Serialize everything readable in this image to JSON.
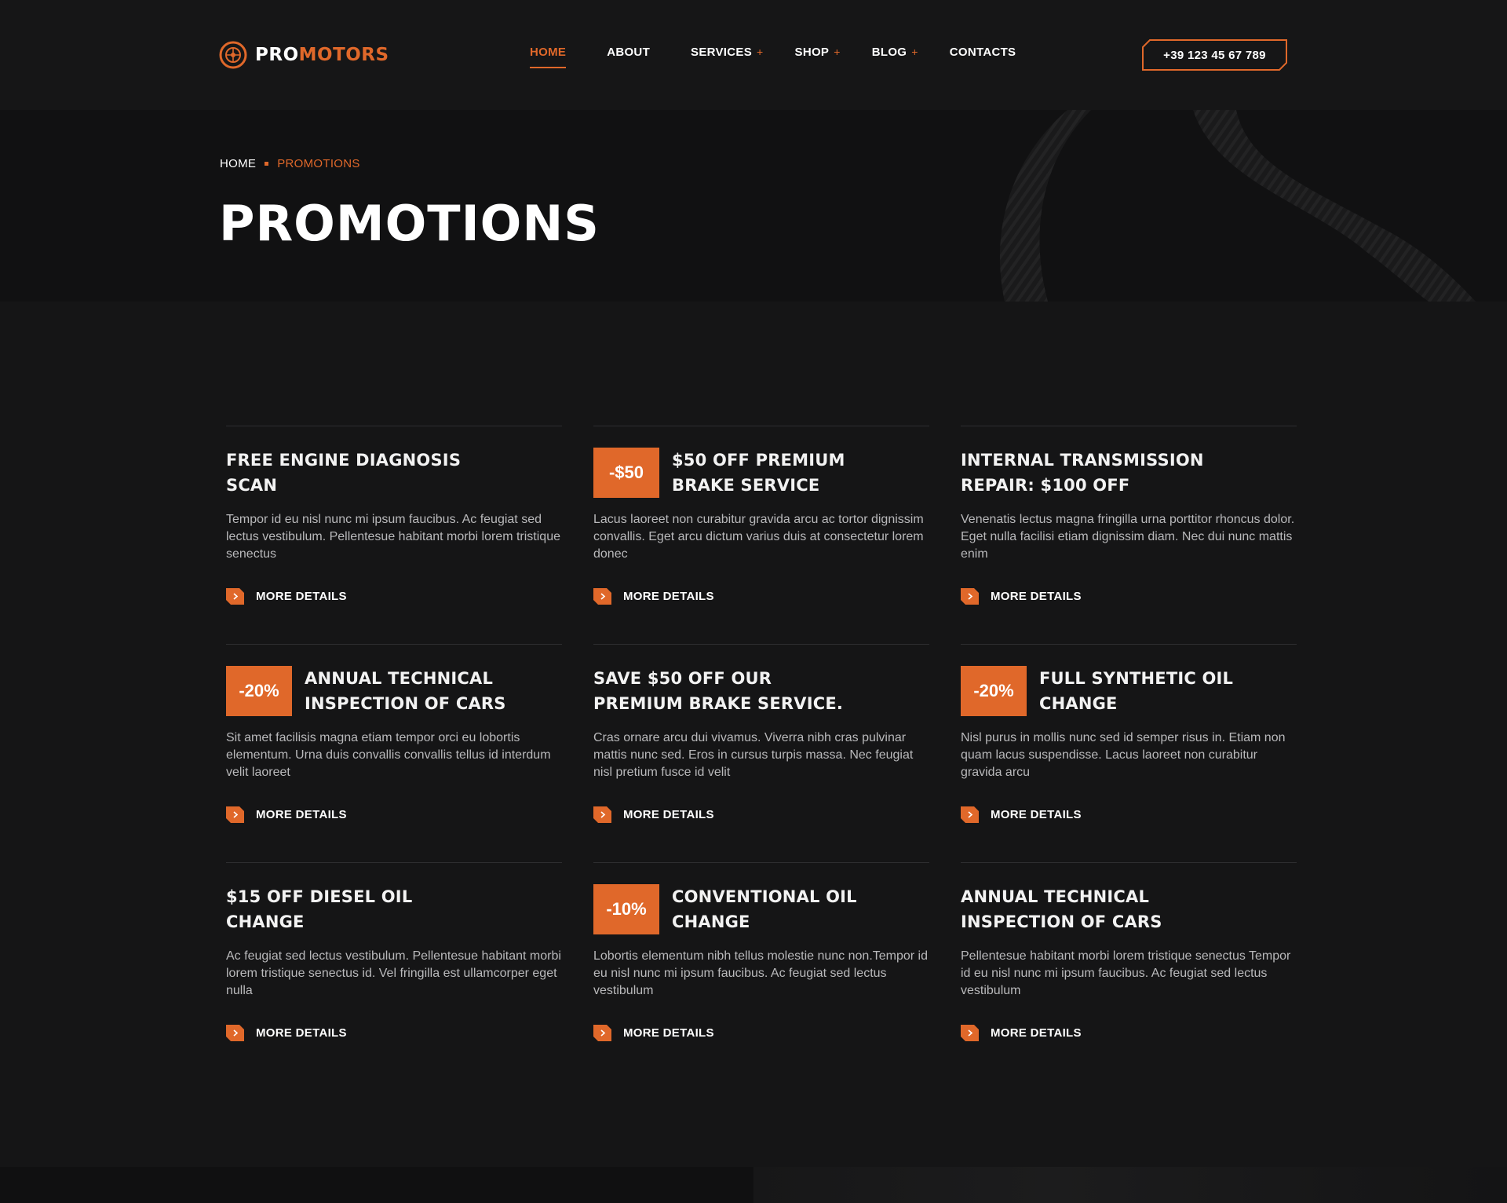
{
  "brand": {
    "logo_part1": "PRO",
    "logo_part2": "MOTORS",
    "accent": "#e0682a",
    "background": "#151516"
  },
  "nav": {
    "items": [
      {
        "label": "HOME",
        "active": true,
        "has_submenu": false
      },
      {
        "label": "ABOUT",
        "active": false,
        "has_submenu": false
      },
      {
        "label": "SERVICES",
        "active": false,
        "has_submenu": true
      },
      {
        "label": "SHOP",
        "active": false,
        "has_submenu": true
      },
      {
        "label": "BLOG",
        "active": false,
        "has_submenu": true
      },
      {
        "label": "CONTACTS",
        "active": false,
        "has_submenu": false
      }
    ],
    "submenu_marker": "+"
  },
  "header": {
    "phone": "+39 123 45 67 789"
  },
  "hero": {
    "breadcrumb": {
      "home": "HOME",
      "current": "PROMOTIONS"
    },
    "title": "PROMOTIONS"
  },
  "promotions": [
    {
      "badge": "",
      "title": "FREE ENGINE DIAGNOSIS SCAN",
      "text": "Tempor id eu nisl nunc mi ipsum faucibus. Ac feugiat sed lectus vestibulum. Pellentesue habitant morbi lorem tristique senectus",
      "link": "MORE DETAILS"
    },
    {
      "badge": "-$50",
      "title": "$50 OFF PREMIUM BRAKE SERVICE",
      "text": "Lacus laoreet non curabitur gravida arcu ac tortor dignissim convallis. Eget arcu dictum varius duis at consectetur lorem donec",
      "link": "MORE DETAILS"
    },
    {
      "badge": "",
      "title": "INTERNAL TRANSMISSION REPAIR: $100 OFF",
      "text": "Venenatis lectus magna fringilla urna porttitor rhoncus dolor. Eget nulla facilisi etiam dignissim diam. Nec dui nunc mattis enim",
      "link": "MORE DETAILS"
    },
    {
      "badge": "-20%",
      "title": "ANNUAL TECHNICAL INSPECTION OF CARS",
      "text": "Sit amet facilisis magna etiam tempor orci eu lobortis elementum. Urna duis convallis convallis tellus id interdum velit laoreet",
      "link": "MORE DETAILS"
    },
    {
      "badge": "",
      "title": "SAVE $50 OFF OUR PREMIUM BRAKE SERVICE.",
      "text": "Cras ornare arcu dui vivamus. Viverra nibh cras pulvinar mattis nunc sed. Eros in cursus turpis massa. Nec feugiat nisl pretium fusce id velit",
      "link": "MORE DETAILS"
    },
    {
      "badge": "-20%",
      "title": "FULL SYNTHETIC OIL CHANGE",
      "text": "Nisl purus in mollis nunc sed id semper risus in. Etiam non quam lacus suspendisse. Lacus laoreet non curabitur gravida arcu",
      "link": "MORE DETAILS"
    },
    {
      "badge": "",
      "title": "$15 OFF DIESEL OIL CHANGE",
      "text": "Ac feugiat sed lectus vestibulum. Pellentesue habitant morbi lorem tristique senectus id. Vel fringilla est ullamcorper eget nulla",
      "link": "MORE DETAILS"
    },
    {
      "badge": "-10%",
      "title": "CONVENTIONAL OIL CHANGE",
      "text": "Lobortis elementum nibh tellus molestie nunc non.Tempor id eu nisl nunc mi ipsum faucibus. Ac feugiat sed lectus vestibulum",
      "link": "MORE DETAILS"
    },
    {
      "badge": "",
      "title": "ANNUAL TECHNICAL INSPECTION OF CARS",
      "text": "Pellentesue habitant morbi lorem tristique senectus Tempor id eu nisl nunc mi ipsum faucibus. Ac feugiat sed lectus vestibulum",
      "link": "MORE DETAILS"
    }
  ]
}
